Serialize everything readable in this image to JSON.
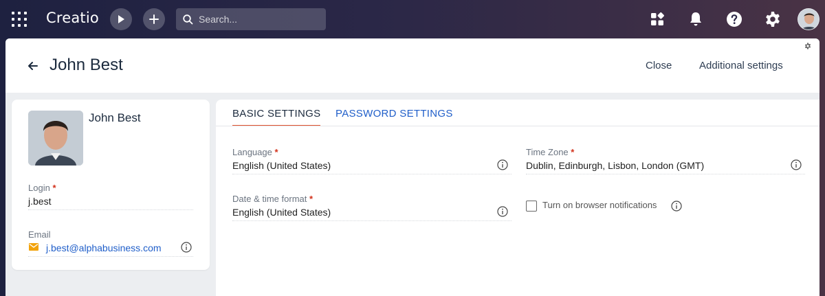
{
  "topbar": {
    "logo": "Creatio",
    "search_placeholder": "Search...",
    "icons": [
      "apps-grid-icon",
      "play-icon",
      "plus-icon",
      "search-icon",
      "dashboard-icon",
      "bell-icon",
      "help-icon",
      "gear-icon",
      "user-avatar"
    ]
  },
  "header": {
    "title": "John Best",
    "close_label": "Close",
    "additional_settings_label": "Additional settings"
  },
  "profile": {
    "name": "John Best",
    "login_label": "Login",
    "login_value": "j.best",
    "email_label": "Email",
    "email_value": "j.best@alphabusiness.com",
    "required_mark": "*"
  },
  "tabs": {
    "basic": "BASIC SETTINGS",
    "password": "PASSWORD SETTINGS"
  },
  "settings": {
    "language_label": "Language",
    "language_value": "English (United States)",
    "timezone_label": "Time Zone",
    "timezone_value": "Dublin, Edinburgh, Lisbon, London (GMT)",
    "datetime_label": "Date & time format",
    "datetime_value": "English (United States)",
    "notifications_label": "Turn on browser notifications",
    "notifications_checked": false
  },
  "colors": {
    "accent_tab": "#e0502c",
    "link": "#1f5ec9",
    "required": "#d2311b",
    "email_icon": "#f2a30c"
  }
}
